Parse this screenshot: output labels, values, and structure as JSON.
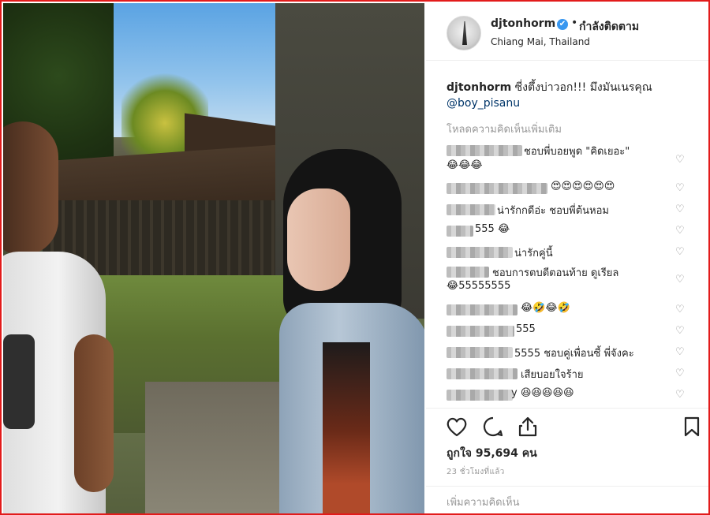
{
  "post": {
    "username": "djtonhorm",
    "follow_status": "กำลังติดตาม",
    "separator": "•",
    "location": "Chiang Mai, Thailand",
    "verified_icon": "✔",
    "caption_user": "djtonhorm",
    "caption_text": "ซี่งตึ้งบ่าวอก!!! มึงมันเนรคุณ",
    "caption_mention": "@boy_pisanu",
    "load_more": "โหลดความคิดเห็นเพิ่มเติม"
  },
  "comments": [
    {
      "text": "ชอบพี่บอยพูด \"คิดเยอะ\"",
      "line2": "😂😂😂"
    },
    {
      "text": "😍😍😍😍😍😍"
    },
    {
      "text": "น่ารักกดีอ่ะ ชอบพี่ต้นหอม"
    },
    {
      "text": "555 😂"
    },
    {
      "text": "น่ารักคู่นี้"
    },
    {
      "text": "ชอบการตบตีตอนท้าย ดูเรียล",
      "line2": "😂55555555"
    },
    {
      "text": "😂🤣😂🤣"
    },
    {
      "text": "555"
    },
    {
      "text": "5555 ชอบคู่เพื่อนซี้ พี่จังคะ"
    },
    {
      "text": "เสียบอยใจร้าย"
    },
    {
      "text": "y 😆😆😆😆😆"
    }
  ],
  "actions": {
    "likes": "ถูกใจ 95,694 คน",
    "time": "23 ชั่วโมงที่แล้ว",
    "comment_placeholder": "เพิ่มความคิดเห็น"
  },
  "icons": {
    "like": "heart-icon",
    "comment": "comment-icon",
    "share": "share-icon",
    "save": "bookmark-icon",
    "comment_like": "heart-icon"
  },
  "colors": {
    "frame_border": "#e21b1b",
    "verified": "#3897f0",
    "mention": "#003569",
    "muted": "#999999"
  }
}
